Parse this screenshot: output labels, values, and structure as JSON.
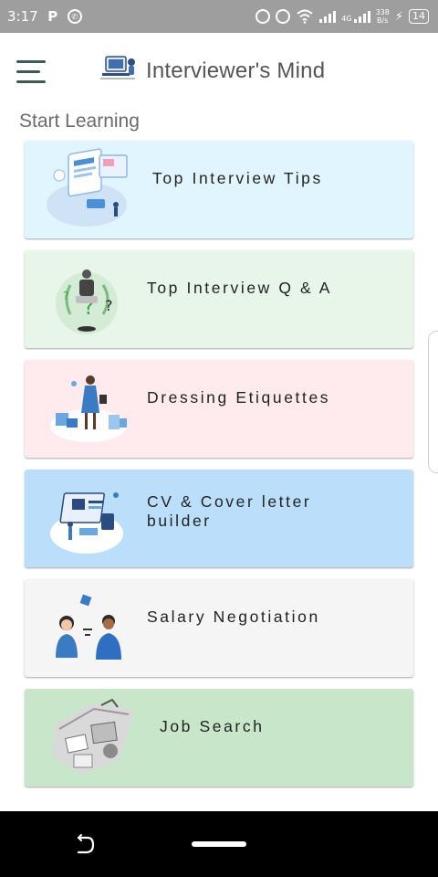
{
  "status_bar": {
    "time": "3:17",
    "network": "4G",
    "speed_value": "338",
    "speed_unit": "B/s",
    "battery": "14"
  },
  "app_bar": {
    "title": "Interviewer's Mind"
  },
  "section_title": "Start Learning",
  "cards": [
    {
      "label": "Top Interview Tips",
      "bg": "#e1f5fe",
      "icon": "interview-tips-illustration"
    },
    {
      "label": "Top Interview Q & A",
      "bg": "#e8f5e9",
      "icon": "question-answer-illustration"
    },
    {
      "label": "Dressing Etiquettes",
      "bg": "#ffebee",
      "icon": "shopping-woman-illustration"
    },
    {
      "label": "CV & Cover letter\nbuilder",
      "bg": "#bbdefb",
      "icon": "cv-builder-illustration"
    },
    {
      "label": "Salary Negotiation",
      "bg": "#f5f5f5",
      "icon": "negotiation-illustration"
    },
    {
      "label": "Job Search",
      "bg": "#c8e6c9",
      "icon": "job-search-illustration"
    }
  ],
  "colors": {
    "status_bar": "#9e9e9e",
    "menu_icon": "#3d5a5a",
    "title_text": "#555555",
    "nav_bar": "#000000"
  }
}
